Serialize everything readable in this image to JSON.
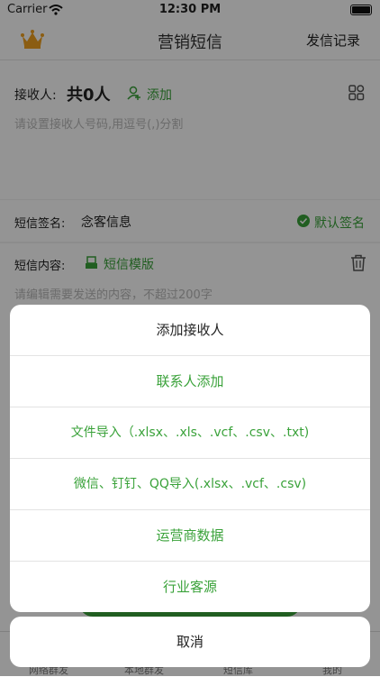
{
  "status": {
    "carrier": "Carrier",
    "time": "12:30 PM"
  },
  "nav": {
    "title": "营销短信",
    "right_label": "发信记录",
    "crown_icon": "crown-icon"
  },
  "recipients": {
    "label": "接收人:",
    "count": "共0人",
    "add_label": "添加",
    "placeholder": "请设置接收人号码,用逗号(,)分割"
  },
  "signature": {
    "label": "短信签名:",
    "value": "念客信息",
    "default_label": "默认签名"
  },
  "content": {
    "label": "短信内容:",
    "template_label": "短信模版",
    "placeholder": "请编辑需要发送的内容，不超过200字"
  },
  "action_sheet": {
    "title": "添加接收人",
    "options": [
      "联系人添加",
      "文件导入（.xlsx、.xls、.vcf、.csv、.txt)",
      "微信、钉钉、QQ导入(.xlsx、.vcf、.csv)",
      "运营商数据",
      "行业客源"
    ],
    "cancel": "取消"
  },
  "tabbar": {
    "items": [
      "网络群发",
      "本地群发",
      "短信库",
      "我的"
    ]
  },
  "colors": {
    "accent": "#3aa23a",
    "crown": "#f0a020"
  }
}
